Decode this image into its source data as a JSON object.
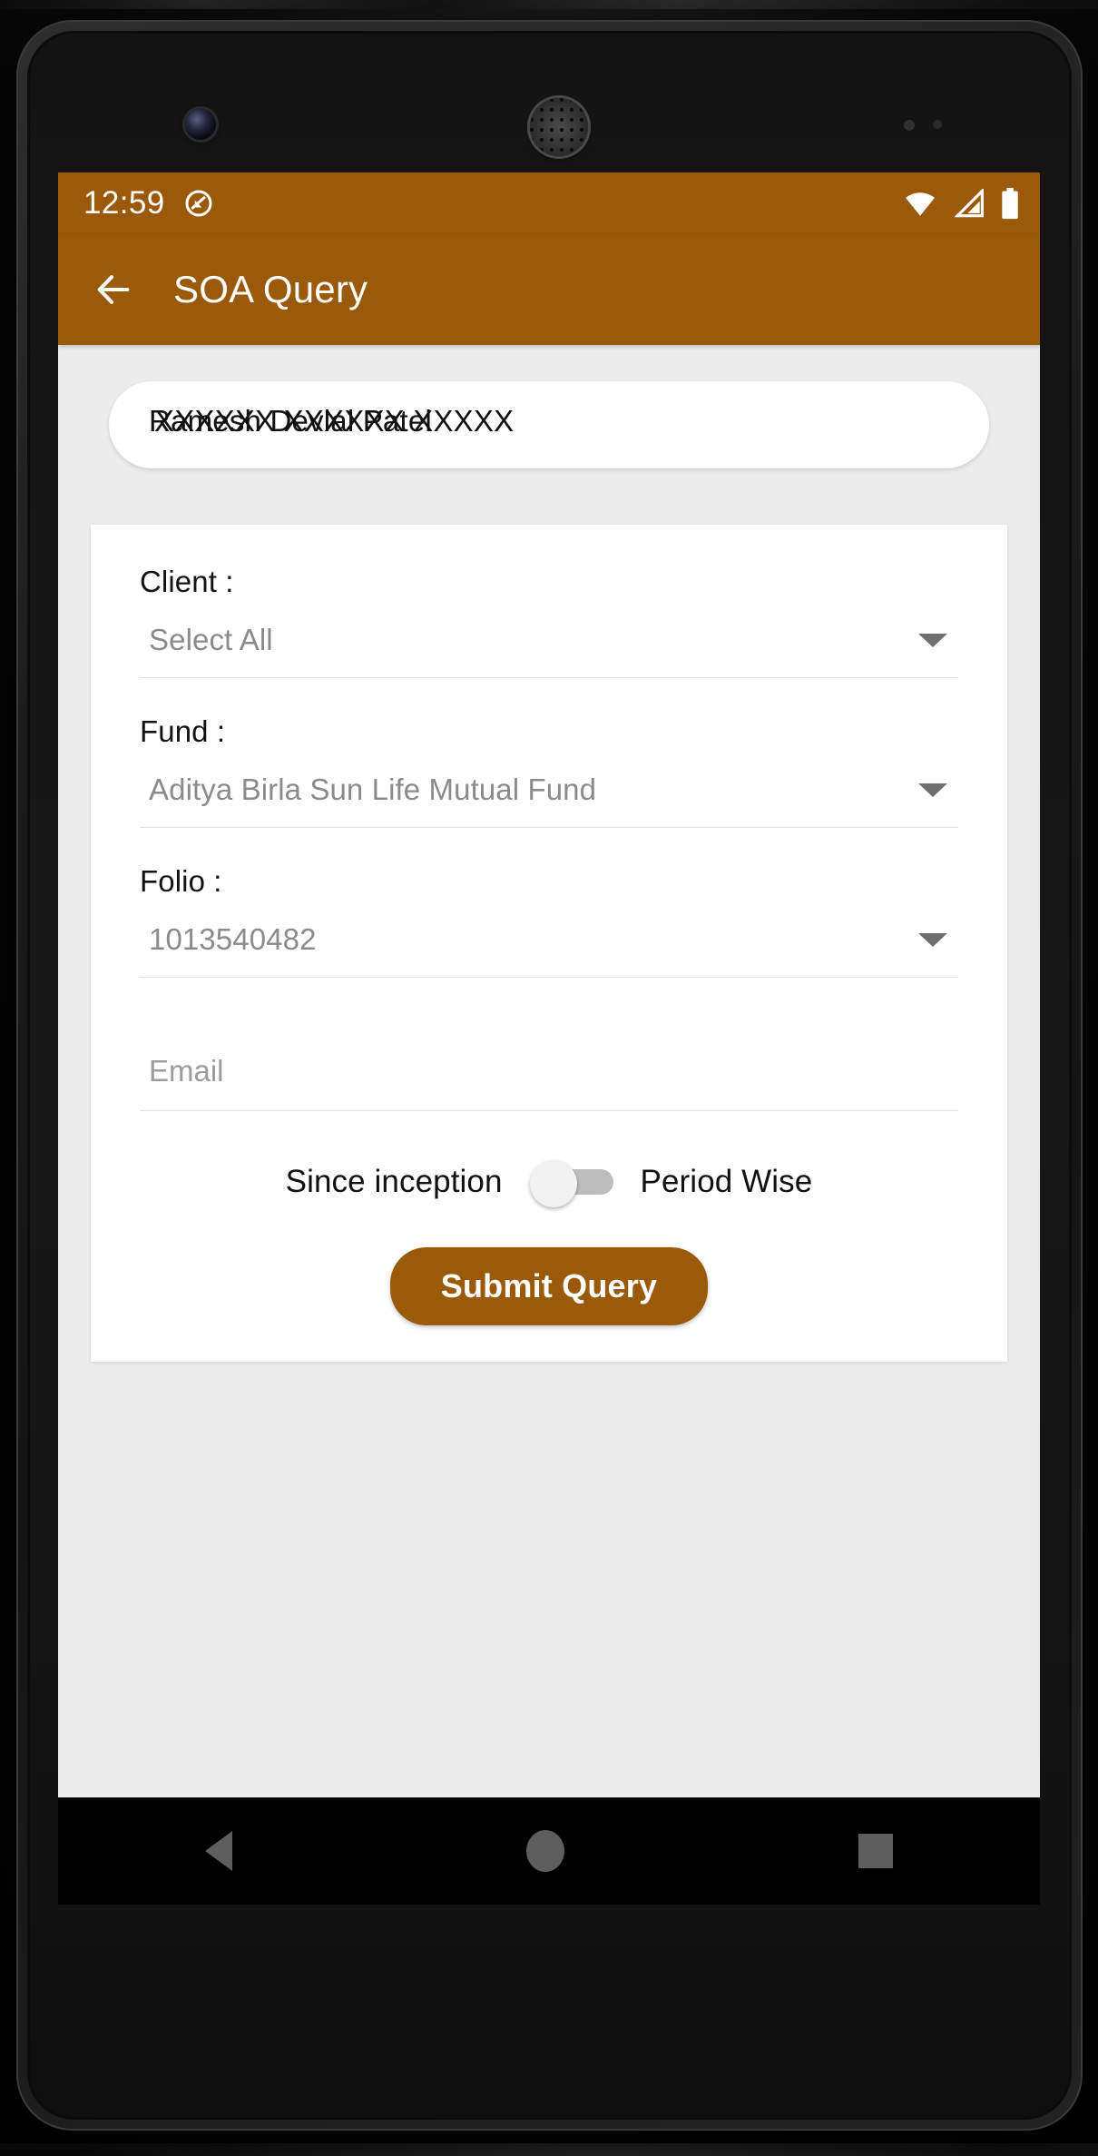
{
  "device": {
    "nav_bar": {
      "back_label": "back",
      "home_label": "home",
      "recents_label": "recents"
    }
  },
  "status_bar": {
    "time": "12:59",
    "icons": [
      "dnd-icon",
      "wifi-icon",
      "signal-icon",
      "battery-icon"
    ],
    "background_color": "#9a5a09"
  },
  "app_bar": {
    "back_icon": "arrow-left-icon",
    "title": "SOA Query",
    "background_color": "#9a5a09",
    "text_color": "#ffffff"
  },
  "name_pill": {
    "text_layer_1": "Ramesh Devlal Patel",
    "text_layer_2": "XXXXXX XXXXXX XXXXX"
  },
  "form": {
    "client": {
      "label": "Client :",
      "value": "Select All",
      "caret_icon": "chevron-down-icon"
    },
    "fund": {
      "label": "Fund :",
      "value": "Aditya Birla Sun Life Mutual Fund",
      "caret_icon": "chevron-down-icon"
    },
    "folio": {
      "label": "Folio :",
      "value": "1013540482",
      "caret_icon": "chevron-down-icon"
    },
    "email": {
      "placeholder": "Email",
      "value": ""
    },
    "period_toggle": {
      "left_label": "Since inception",
      "right_label": "Period Wise",
      "state": "off"
    },
    "submit": {
      "label": "Submit Query",
      "background_color": "#9a5a09"
    }
  }
}
